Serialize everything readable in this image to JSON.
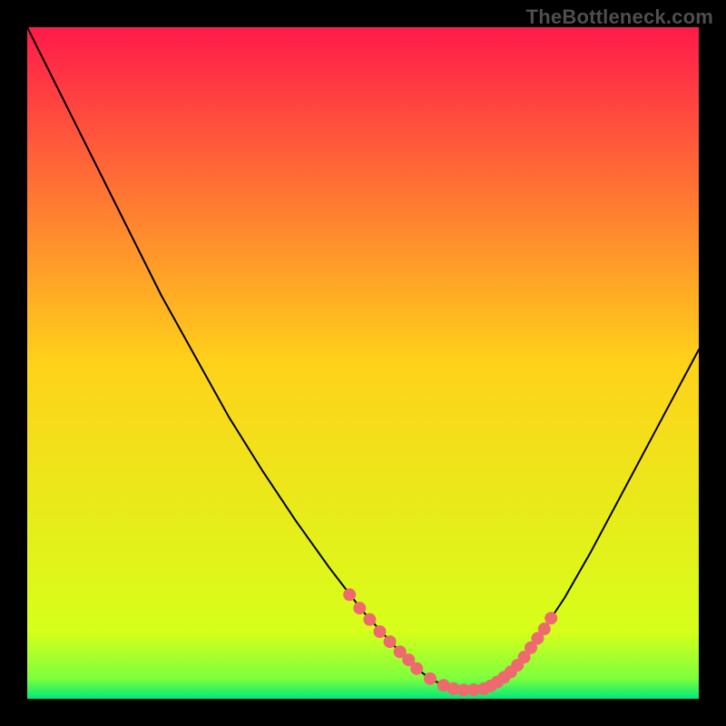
{
  "watermark": "TheBottleneck.com",
  "chart_data": {
    "type": "line",
    "title": "",
    "xlabel": "",
    "ylabel": "",
    "xlim": [
      0,
      100
    ],
    "ylim": [
      0,
      100
    ],
    "grid": false,
    "legend": false,
    "background_gradient": {
      "stops": [
        {
          "offset": 0.0,
          "color": "#ff1a4b"
        },
        {
          "offset": 0.5,
          "color": "#ffd21a"
        },
        {
          "offset": 0.9,
          "color": "#d6ff1a"
        },
        {
          "offset": 0.97,
          "color": "#7dff3d"
        },
        {
          "offset": 1.0,
          "color": "#00e87a"
        }
      ]
    },
    "series": [
      {
        "name": "bottleneck-curve",
        "color": "#000000",
        "x": [
          0,
          5,
          10,
          15,
          20,
          25,
          30,
          35,
          40,
          45,
          50,
          55,
          58,
          60,
          62,
          65,
          68,
          70,
          73,
          76,
          80,
          84,
          88,
          92,
          96,
          100
        ],
        "y": [
          100,
          90,
          80,
          70,
          60,
          51,
          42,
          34,
          26.5,
          19.5,
          13,
          7.5,
          4.5,
          3,
          2,
          1.3,
          1.5,
          2.5,
          5,
          9,
          15,
          22,
          29.5,
          37,
          44.5,
          52
        ]
      }
    ],
    "markers": {
      "name": "highlight-clusters",
      "color": "#ee6a6f",
      "radius_px": 7,
      "points": [
        {
          "x": 48,
          "y": 15.5
        },
        {
          "x": 49.5,
          "y": 13.5
        },
        {
          "x": 51,
          "y": 11.8
        },
        {
          "x": 52.5,
          "y": 10
        },
        {
          "x": 54,
          "y": 8.5
        },
        {
          "x": 55.5,
          "y": 7
        },
        {
          "x": 56.8,
          "y": 5.8
        },
        {
          "x": 58,
          "y": 4.5
        },
        {
          "x": 60,
          "y": 3
        },
        {
          "x": 62,
          "y": 2
        },
        {
          "x": 63.5,
          "y": 1.5
        },
        {
          "x": 65,
          "y": 1.3
        },
        {
          "x": 66.5,
          "y": 1.35
        },
        {
          "x": 68,
          "y": 1.5
        },
        {
          "x": 69,
          "y": 1.9
        },
        {
          "x": 70,
          "y": 2.5
        },
        {
          "x": 71,
          "y": 3.2
        },
        {
          "x": 72,
          "y": 4
        },
        {
          "x": 73,
          "y": 5
        },
        {
          "x": 74,
          "y": 6.2
        },
        {
          "x": 75,
          "y": 7.6
        },
        {
          "x": 76,
          "y": 9
        },
        {
          "x": 77,
          "y": 10.4
        },
        {
          "x": 78,
          "y": 12
        }
      ]
    }
  }
}
